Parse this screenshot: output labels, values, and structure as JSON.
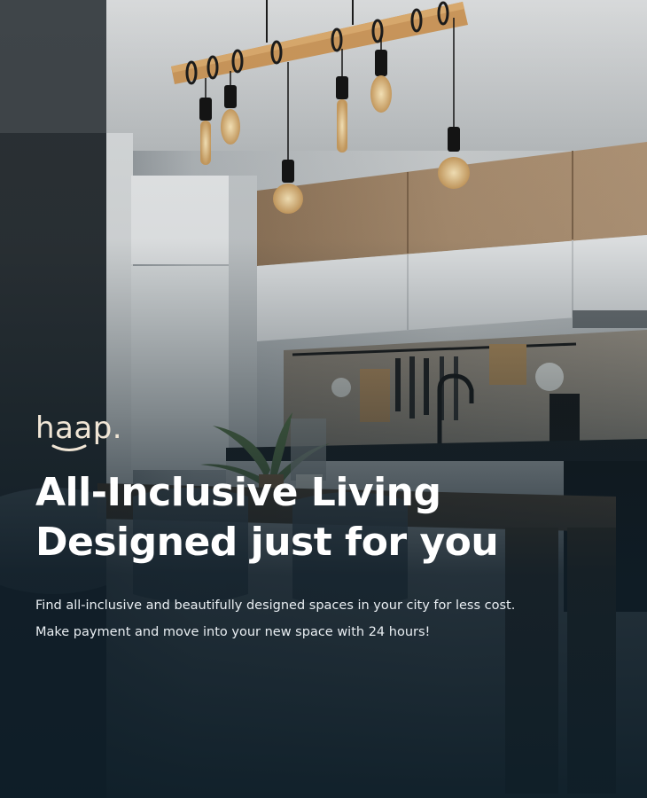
{
  "brand": {
    "logo_text": "haap."
  },
  "hero": {
    "headline_line1": "All-Inclusive Living",
    "headline_line2": "Designed just for you",
    "description_line1": "Find all-inclusive and beautifully designed spaces in your city for less cost.",
    "description_line2": "Make payment and move into your new space with 24 hours!"
  },
  "colors": {
    "headline": "#ffffff",
    "logo": "#f1e6d6",
    "background_dark": "#0f1c24",
    "wood_accent": "#c89a5c"
  },
  "icons": {
    "logo_smile": "smile-curve-icon"
  }
}
